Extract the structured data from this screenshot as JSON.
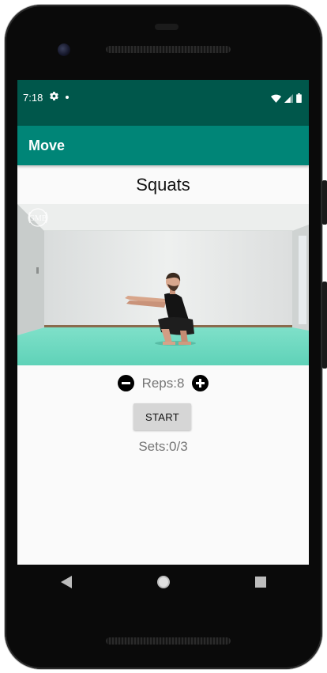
{
  "status_bar": {
    "time": "7:18",
    "icons": [
      "gear-icon",
      "dot-icon",
      "wifi-icon",
      "signal-icon",
      "battery-icon"
    ]
  },
  "app_bar": {
    "title": "Move"
  },
  "exercise": {
    "title": "Squats",
    "video_watermark": "GMB"
  },
  "reps": {
    "label": "Reps:8",
    "decrement_icon": "minus-circle-icon",
    "increment_icon": "plus-circle-icon"
  },
  "controls": {
    "start_label": "START"
  },
  "sets": {
    "label": "Sets:0/3"
  },
  "nav": {
    "icons": [
      "back-icon",
      "home-icon",
      "recents-icon"
    ]
  },
  "colors": {
    "status_bar": "#00574b",
    "app_bar": "#008577",
    "floor": "#74dcc4",
    "background": "#fafafa"
  }
}
